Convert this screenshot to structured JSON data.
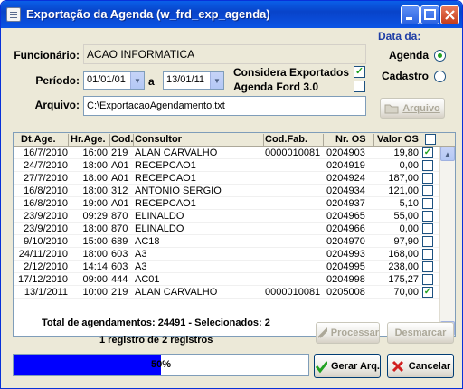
{
  "window": {
    "title": "Exportação da Agenda (w_frd_exp_agenda)"
  },
  "form": {
    "funcionario_label": "Funcionário:",
    "funcionario_value": "ACAO INFORMATICA",
    "periodo_label": "Período:",
    "date_from": "01/01/01",
    "date_sep": "a",
    "date_to": "13/01/11",
    "considera_label": "Considera Exportados",
    "considera_checked": true,
    "agenda_ford_label": "Agenda Ford 3.0",
    "agenda_ford_checked": false,
    "arquivo_label": "Arquivo:",
    "arquivo_value": "C:\\ExportacaoAgendamento.txt",
    "arquivo_button": "Arquivo"
  },
  "data_da": {
    "label": "Data da:",
    "options": [
      {
        "label": "Agenda",
        "selected": true
      },
      {
        "label": "Cadastro",
        "selected": false
      }
    ]
  },
  "grid": {
    "columns": [
      "Dt.Age.",
      "Hr.Age.",
      "Cod.",
      "Consultor",
      "Cod.Fab.",
      "Nr. OS",
      "Valor OS"
    ],
    "rows": [
      {
        "dt": "16/7/2010",
        "hr": "16:00",
        "cod": "219",
        "consultor": "ALAN CARVALHO",
        "codfab": "0000010081",
        "os": "0204903",
        "valor": "19,80",
        "checked": true
      },
      {
        "dt": "24/7/2010",
        "hr": "18:00",
        "cod": "A01",
        "consultor": "RECEPCAO1",
        "codfab": "",
        "os": "0204919",
        "valor": "0,00",
        "checked": false
      },
      {
        "dt": "27/7/2010",
        "hr": "18:00",
        "cod": "A01",
        "consultor": "RECEPCAO1",
        "codfab": "",
        "os": "0204924",
        "valor": "187,00",
        "checked": false
      },
      {
        "dt": "16/8/2010",
        "hr": "18:00",
        "cod": "312",
        "consultor": "ANTONIO SERGIO",
        "codfab": "",
        "os": "0204934",
        "valor": "121,00",
        "checked": false
      },
      {
        "dt": "16/8/2010",
        "hr": "19:00",
        "cod": "A01",
        "consultor": "RECEPCAO1",
        "codfab": "",
        "os": "0204937",
        "valor": "5,10",
        "checked": false
      },
      {
        "dt": "23/9/2010",
        "hr": "09:29",
        "cod": "870",
        "consultor": "ELINALDO",
        "codfab": "",
        "os": "0204965",
        "valor": "55,00",
        "checked": false
      },
      {
        "dt": "23/9/2010",
        "hr": "18:00",
        "cod": "870",
        "consultor": "ELINALDO",
        "codfab": "",
        "os": "0204966",
        "valor": "0,00",
        "checked": false
      },
      {
        "dt": "9/10/2010",
        "hr": "15:00",
        "cod": "689",
        "consultor": "AC18",
        "codfab": "",
        "os": "0204970",
        "valor": "97,90",
        "checked": false
      },
      {
        "dt": "24/11/2010",
        "hr": "18:00",
        "cod": "603",
        "consultor": "A3",
        "codfab": "",
        "os": "0204993",
        "valor": "168,00",
        "checked": false
      },
      {
        "dt": "2/12/2010",
        "hr": "14:14",
        "cod": "603",
        "consultor": "A3",
        "codfab": "",
        "os": "0204995",
        "valor": "238,00",
        "checked": false
      },
      {
        "dt": "17/12/2010",
        "hr": "09:00",
        "cod": "444",
        "consultor": "AC01",
        "codfab": "",
        "os": "0204998",
        "valor": "175,27",
        "checked": false
      },
      {
        "dt": "13/1/2011",
        "hr": "10:00",
        "cod": "219",
        "consultor": "ALAN CARVALHO",
        "codfab": "0000010081",
        "os": "0205008",
        "valor": "70,00",
        "checked": true
      }
    ]
  },
  "status": {
    "total": "Total de agendamentos: 24491 - Selecionados: 2",
    "registro": "1 registro de 2 registros",
    "progress_text": "50%",
    "progress_value": 0.5
  },
  "buttons": {
    "processar": "Processar",
    "desmarcar": "Desmarcar",
    "gerar": "Gerar Arq.",
    "cancelar": "Cancelar"
  },
  "colors": {
    "accent": "#0000ff",
    "title_bar": "#0a5fe8",
    "check": "#21a121"
  }
}
